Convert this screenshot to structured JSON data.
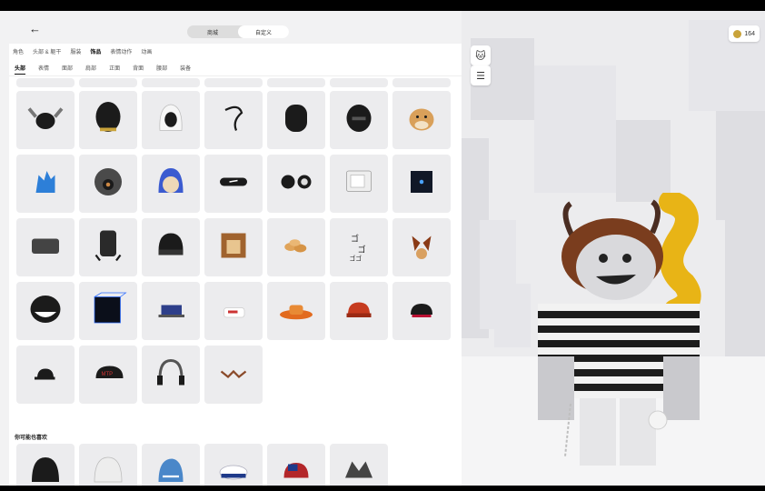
{
  "header": {
    "back_icon": "arrow-left-icon",
    "segments": [
      "商城",
      "自定义"
    ],
    "active_segment": 1
  },
  "tabs_primary": [
    "角色",
    "头部 & 躯干",
    "服装",
    "饰品",
    "表情动作",
    "动画"
  ],
  "tabs_primary_active": 3,
  "tabs_secondary": [
    "头部",
    "表情",
    "面部",
    "肩部",
    "正面",
    "背面",
    "腰部",
    "装备"
  ],
  "tabs_secondary_active": 0,
  "grid": {
    "items": [
      {
        "icon": "horned-helmet-icon"
      },
      {
        "icon": "black-helmet-icon"
      },
      {
        "icon": "white-hood-icon"
      },
      {
        "icon": "headphone-wire-icon"
      },
      {
        "icon": "black-mask-icon"
      },
      {
        "icon": "black-hood-icon"
      },
      {
        "icon": "doge-head-icon"
      },
      {
        "icon": "blue-spiky-hair-icon"
      },
      {
        "icon": "gas-mask-icon"
      },
      {
        "icon": "blue-hood-icon"
      },
      {
        "icon": "headband-icon"
      },
      {
        "icon": "earmuffs-icon"
      },
      {
        "icon": "retro-tv-icon"
      },
      {
        "icon": "dark-cube-icon"
      },
      {
        "icon": "grey-band-icon"
      },
      {
        "icon": "tech-headset-icon"
      },
      {
        "icon": "black-beanie-icon"
      },
      {
        "icon": "box-head-icon"
      },
      {
        "icon": "cookies-icon"
      },
      {
        "icon": "go-go-text-icon"
      },
      {
        "icon": "fox-ears-icon"
      },
      {
        "icon": "troll-face-icon"
      },
      {
        "icon": "blue-wire-cube-icon"
      },
      {
        "icon": "blue-cap-icon"
      },
      {
        "icon": "white-cap-icon"
      },
      {
        "icon": "orange-fedora-icon"
      },
      {
        "icon": "red-cap-icon"
      },
      {
        "icon": "red-black-cap-icon"
      },
      {
        "icon": "black-cap-icon"
      },
      {
        "icon": "black-red-cap-icon"
      },
      {
        "icon": "headphones-icon"
      },
      {
        "icon": "antlers-icon"
      }
    ]
  },
  "suggested": {
    "label": "你可能也喜欢",
    "items": [
      {
        "icon": "black-ear-hat-icon"
      },
      {
        "icon": "white-fur-hat-icon"
      },
      {
        "icon": "shark-hat-icon"
      },
      {
        "icon": "sailor-hat-icon"
      },
      {
        "icon": "usa-cap-icon"
      },
      {
        "icon": "jester-hat-icon"
      }
    ]
  },
  "viewport": {
    "currency_value": "164",
    "avatar_thumb_icon": "cat-avatar-icon",
    "settings_icon": "sliders-icon"
  },
  "colors": {
    "accent": "#e34b2b",
    "tile_bg": "#ececee"
  }
}
